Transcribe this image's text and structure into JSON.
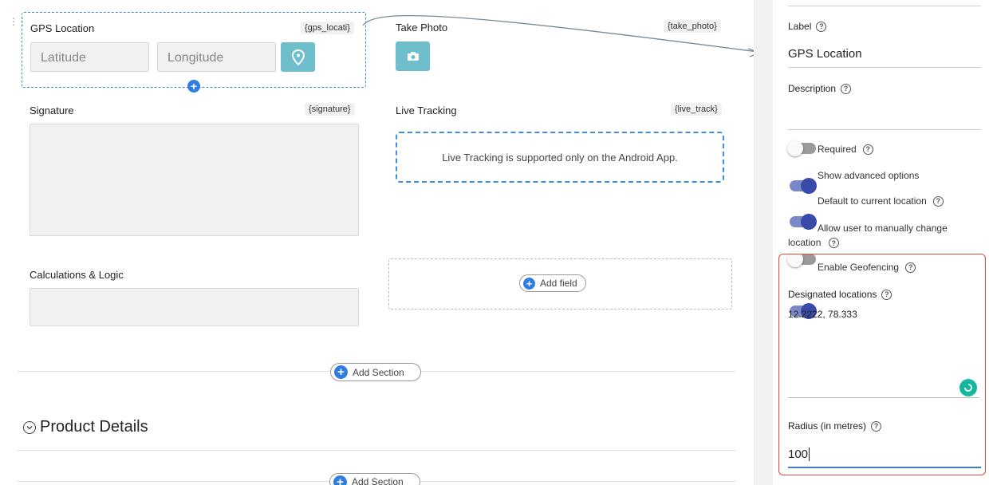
{
  "form": {
    "gps": {
      "title": "GPS Location",
      "key": "{gps_locati}",
      "lat_placeholder": "Latitude",
      "lng_placeholder": "Longitude"
    },
    "photo": {
      "title": "Take Photo",
      "key": "{take_photo}"
    },
    "signature": {
      "title": "Signature",
      "key": "{signature}"
    },
    "live": {
      "title": "Live Tracking",
      "key": "{live_track}",
      "message": "Live Tracking is supported only on the Android App."
    },
    "calc": {
      "title": "Calculations & Logic"
    },
    "add_field": "Add field",
    "add_section": "Add Section",
    "section_title": "Product Details"
  },
  "panel": {
    "label": {
      "title": "Label",
      "value": "GPS Location"
    },
    "description": {
      "title": "Description",
      "value": ""
    },
    "toggles": [
      {
        "label": "Required",
        "on": false
      },
      {
        "label": "Show advanced options",
        "on": true
      },
      {
        "label": "Default to current location",
        "on": true
      },
      {
        "label": "Allow user to manually change location",
        "on": false
      },
      {
        "label": "Enable Geofencing",
        "on": true
      }
    ],
    "designated": {
      "title": "Designated locations",
      "value": "12.2222, 78.333"
    },
    "radius": {
      "title": "Radius (in metres)",
      "value": "100"
    }
  },
  "colors": {
    "accent_blue": "#2f7de1",
    "teal": "#6fbecb",
    "toggle_on": "#3a4aa8",
    "highlight_red": "#e84a3a",
    "grammar_green": "#14b8a0"
  },
  "icons": [
    "drag-handle-icon",
    "location-pin-icon",
    "camera-icon",
    "plus-circle-icon",
    "chevron-down-circle-icon",
    "help-icon",
    "grammar-check-icon"
  ]
}
